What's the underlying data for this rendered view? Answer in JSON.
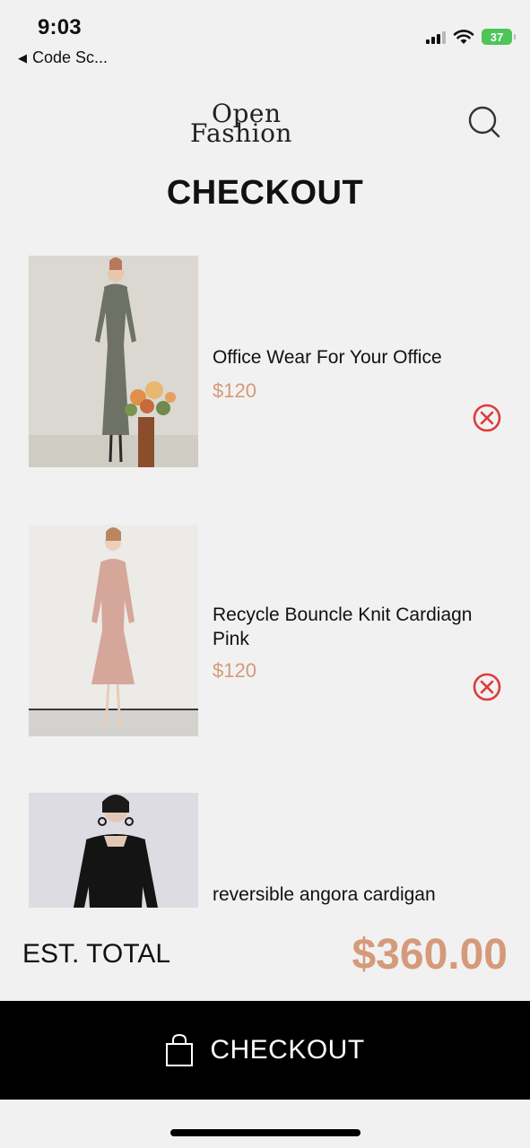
{
  "status_bar": {
    "time": "9:03",
    "back_app": "Code Sc...",
    "battery": "37"
  },
  "header": {
    "logo_line1": "Open",
    "logo_line2": "Fashion",
    "search_icon": "search-icon"
  },
  "page_title": "CHECKOUT",
  "cart": {
    "items": [
      {
        "name": "Office Wear For Your Office",
        "price": "$120"
      },
      {
        "name": "Recycle Bouncle Knit Cardiagn Pink",
        "price": "$120"
      },
      {
        "name": "reversible angora cardigan",
        "price": ""
      }
    ]
  },
  "summary": {
    "total_label": "EST. TOTAL",
    "total_value": "$360.00"
  },
  "checkout_button": {
    "label": "CHECKOUT",
    "icon": "shopping-bag-icon"
  },
  "colors": {
    "background": "#f2f1f1",
    "accent": "#d49a7a",
    "remove": "#e03a3a",
    "button": "#000000"
  }
}
